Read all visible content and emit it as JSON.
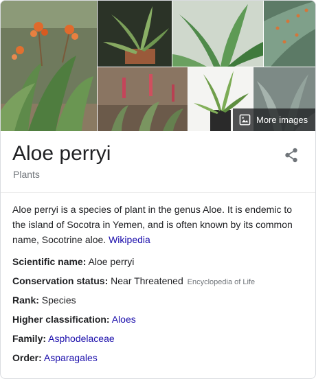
{
  "gallery": {
    "more_images_label": "More images"
  },
  "entity": {
    "title": "Aloe perryi",
    "category": "Plants"
  },
  "description": {
    "text": "Aloe perryi is a species of plant in the genus Aloe. It is endemic to the island of Socotra in Yemen, and is often known by its common name, Socotrine aloe.",
    "source_link": "Wikipedia"
  },
  "facts": {
    "scientific_name": {
      "label": "Scientific name:",
      "value": "Aloe perryi"
    },
    "conservation_status": {
      "label": "Conservation status:",
      "value": "Near Threatened",
      "source": "Encyclopedia of Life"
    },
    "rank": {
      "label": "Rank:",
      "value": "Species"
    },
    "higher_classification": {
      "label": "Higher classification:",
      "value": "Aloes"
    },
    "family": {
      "label": "Family:",
      "value": "Asphodelaceae"
    },
    "order": {
      "label": "Order:",
      "value": "Asparagales"
    }
  },
  "colors": {
    "link": "#1a0dab",
    "secondary_text": "#70757a",
    "primary_text": "#202124"
  },
  "icons": {
    "share": "share-icon",
    "image": "image-icon"
  }
}
